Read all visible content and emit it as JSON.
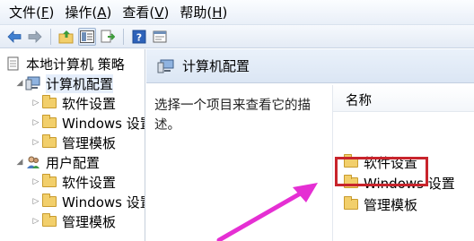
{
  "menu": [
    {
      "text": "文件(",
      "key": "F",
      "tail": ")"
    },
    {
      "text": "操作(",
      "key": "A",
      "tail": ")"
    },
    {
      "text": "查看(",
      "key": "V",
      "tail": ")"
    },
    {
      "text": "帮助(",
      "key": "H",
      "tail": ")"
    }
  ],
  "toolbar": {
    "icons": [
      "back-arrow-icon",
      "forward-arrow-icon",
      "up-folder-icon",
      "show-hide-tree-icon",
      "export-list-icon",
      "help-icon",
      "properties-icon"
    ]
  },
  "tree": {
    "root": "本地计算机 策略",
    "computer_config": "计算机配置",
    "computer_children": [
      "软件设置",
      "Windows 设置",
      "管理模板"
    ],
    "user_config": "用户配置",
    "user_children": [
      "软件设置",
      "Windows 设置",
      "管理模板"
    ]
  },
  "right": {
    "title": "计算机配置",
    "description_line1": "选择一个项目来查看它的描",
    "description_line2": "述。",
    "column_header": "名称",
    "items": [
      "软件设置",
      "Windows 设置",
      "管理模板"
    ]
  },
  "colors": {
    "highlight_box": "#c8242c",
    "arrow": "#e52fd3",
    "folder": "#f2cf6b"
  }
}
